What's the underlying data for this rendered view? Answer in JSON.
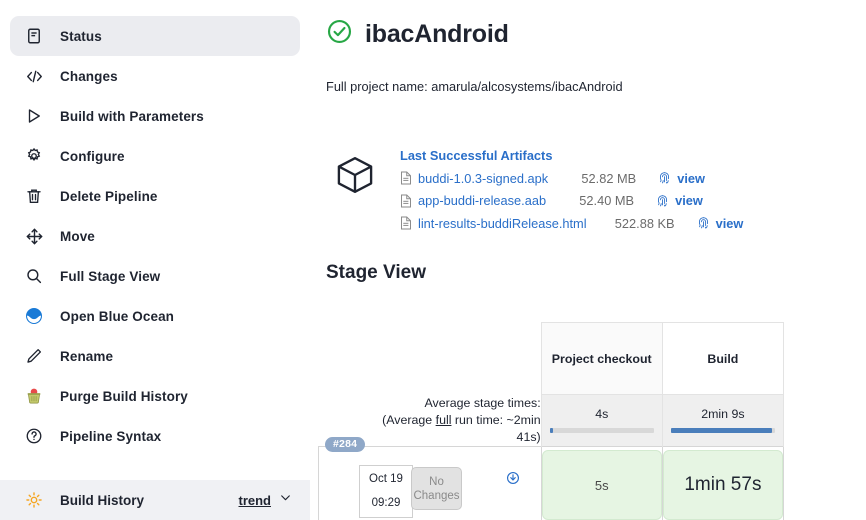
{
  "sidebar": {
    "items": [
      {
        "label": "Status",
        "icon": "document-icon",
        "active": true
      },
      {
        "label": "Changes",
        "icon": "code-brackets-icon",
        "active": false
      },
      {
        "label": "Build with Parameters",
        "icon": "play-triangle-icon",
        "active": false
      },
      {
        "label": "Configure",
        "icon": "gear-icon",
        "active": false
      },
      {
        "label": "Delete Pipeline",
        "icon": "trash-icon",
        "active": false
      },
      {
        "label": "Move",
        "icon": "move-arrows-icon",
        "active": false
      },
      {
        "label": "Full Stage View",
        "icon": "magnifier-icon",
        "active": false
      },
      {
        "label": "Open Blue Ocean",
        "icon": "blue-ocean-icon",
        "active": false
      },
      {
        "label": "Rename",
        "icon": "pencil-icon",
        "active": false
      },
      {
        "label": "Purge Build History",
        "icon": "purge-trash-icon",
        "active": false
      },
      {
        "label": "Pipeline Syntax",
        "icon": "question-circle-icon",
        "active": false
      }
    ],
    "build_history": {
      "label": "Build History",
      "icon": "weather-sun-icon",
      "trend_label": "trend",
      "chevron": "chevron-down-icon"
    }
  },
  "project": {
    "status_icon": "success-check-circle-icon",
    "title": "ibacAndroid",
    "full_name_line": "Full project name: amarula/alcosystems/ibacAndroid"
  },
  "artifacts": {
    "box_icon": "cube-icon",
    "heading": "Last Successful Artifacts",
    "view_label": "view",
    "items": [
      {
        "name": "buddi-1.0.3-signed.apk",
        "size": "52.82 MB",
        "file_icon": "file-icon",
        "view_icon": "fingerprint-icon"
      },
      {
        "name": "app-buddi-release.aab",
        "size": "52.40 MB",
        "file_icon": "file-icon",
        "view_icon": "fingerprint-icon"
      },
      {
        "name": "lint-results-buddiRelease.html",
        "size": "522.88 KB",
        "file_icon": "file-icon",
        "view_icon": "fingerprint-icon"
      }
    ]
  },
  "stage_view": {
    "title": "Stage View",
    "columns": [
      {
        "name": "Project checkout"
      },
      {
        "name": "Build"
      }
    ],
    "average_label_line1": "Average stage times:",
    "average_label_line2_pre": "(Average ",
    "average_label_line2_underline": "full",
    "average_label_line2_post": " run time: ~2min",
    "average_label_line3": "41s)",
    "averages": [
      {
        "time": "4s",
        "bar_percent": 3
      },
      {
        "time": "2min 9s",
        "bar_percent": 97
      }
    ],
    "run": {
      "build_number": "#284",
      "date_line1": "Oct 19",
      "date_line2": "09:29",
      "changes_line1": "No",
      "changes_line2": "Changes",
      "download_icon": "download-circle-icon",
      "stages": [
        {
          "duration": "5s",
          "size": "small",
          "status_color": "#e6f5e3"
        },
        {
          "duration": "1min 57s",
          "size": "big",
          "status_color": "#e6f5e3"
        }
      ]
    }
  },
  "colors": {
    "link_blue": "#2a6fc9",
    "success_green": "#27a745",
    "stage_green": "#e6f5e3",
    "bar_blue": "#4a7ebb",
    "badge_blue": "#8fa8c8",
    "sidebar_active": "#ebecf0"
  }
}
